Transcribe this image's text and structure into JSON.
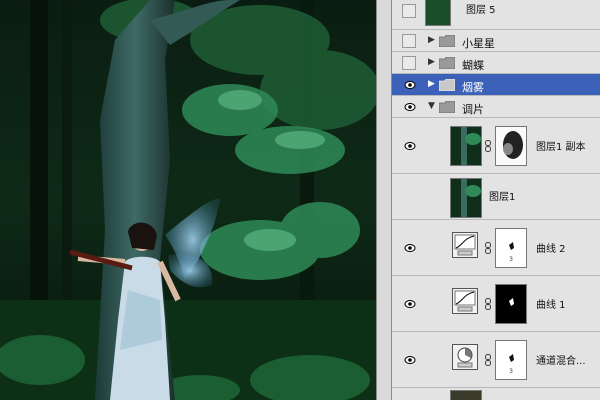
{
  "layers_panel": {
    "layers": [
      {
        "name": "图层 5",
        "type": "layer",
        "visible": true,
        "thumb": "forest"
      },
      {
        "name": "小星星",
        "type": "group",
        "visible": false,
        "expanded": false
      },
      {
        "name": "蝴蝶",
        "type": "group",
        "visible": false,
        "expanded": false
      },
      {
        "name": "烟雾",
        "type": "group",
        "visible": true,
        "expanded": false,
        "selected": true
      },
      {
        "name": "调片",
        "type": "group",
        "visible": true,
        "expanded": true
      },
      {
        "name": "图层1 副本",
        "type": "layer",
        "visible": true,
        "has_mask": true
      },
      {
        "name": "图层1",
        "type": "layer",
        "visible": false
      },
      {
        "name": "曲线 2",
        "type": "adjustment",
        "visible": true,
        "adjustment": "curves",
        "mask": "white"
      },
      {
        "name": "曲线 1",
        "type": "adjustment",
        "visible": true,
        "adjustment": "curves",
        "mask": "black"
      },
      {
        "name": "通道混合...",
        "type": "adjustment",
        "visible": true,
        "adjustment": "channel-mixer",
        "mask": "white"
      }
    ]
  },
  "colors": {
    "panel_bg": "#dcdcdc",
    "row_bg": "#e3e3e3",
    "selected_row": "#3b62b8",
    "separator": "#b9b9b9"
  }
}
